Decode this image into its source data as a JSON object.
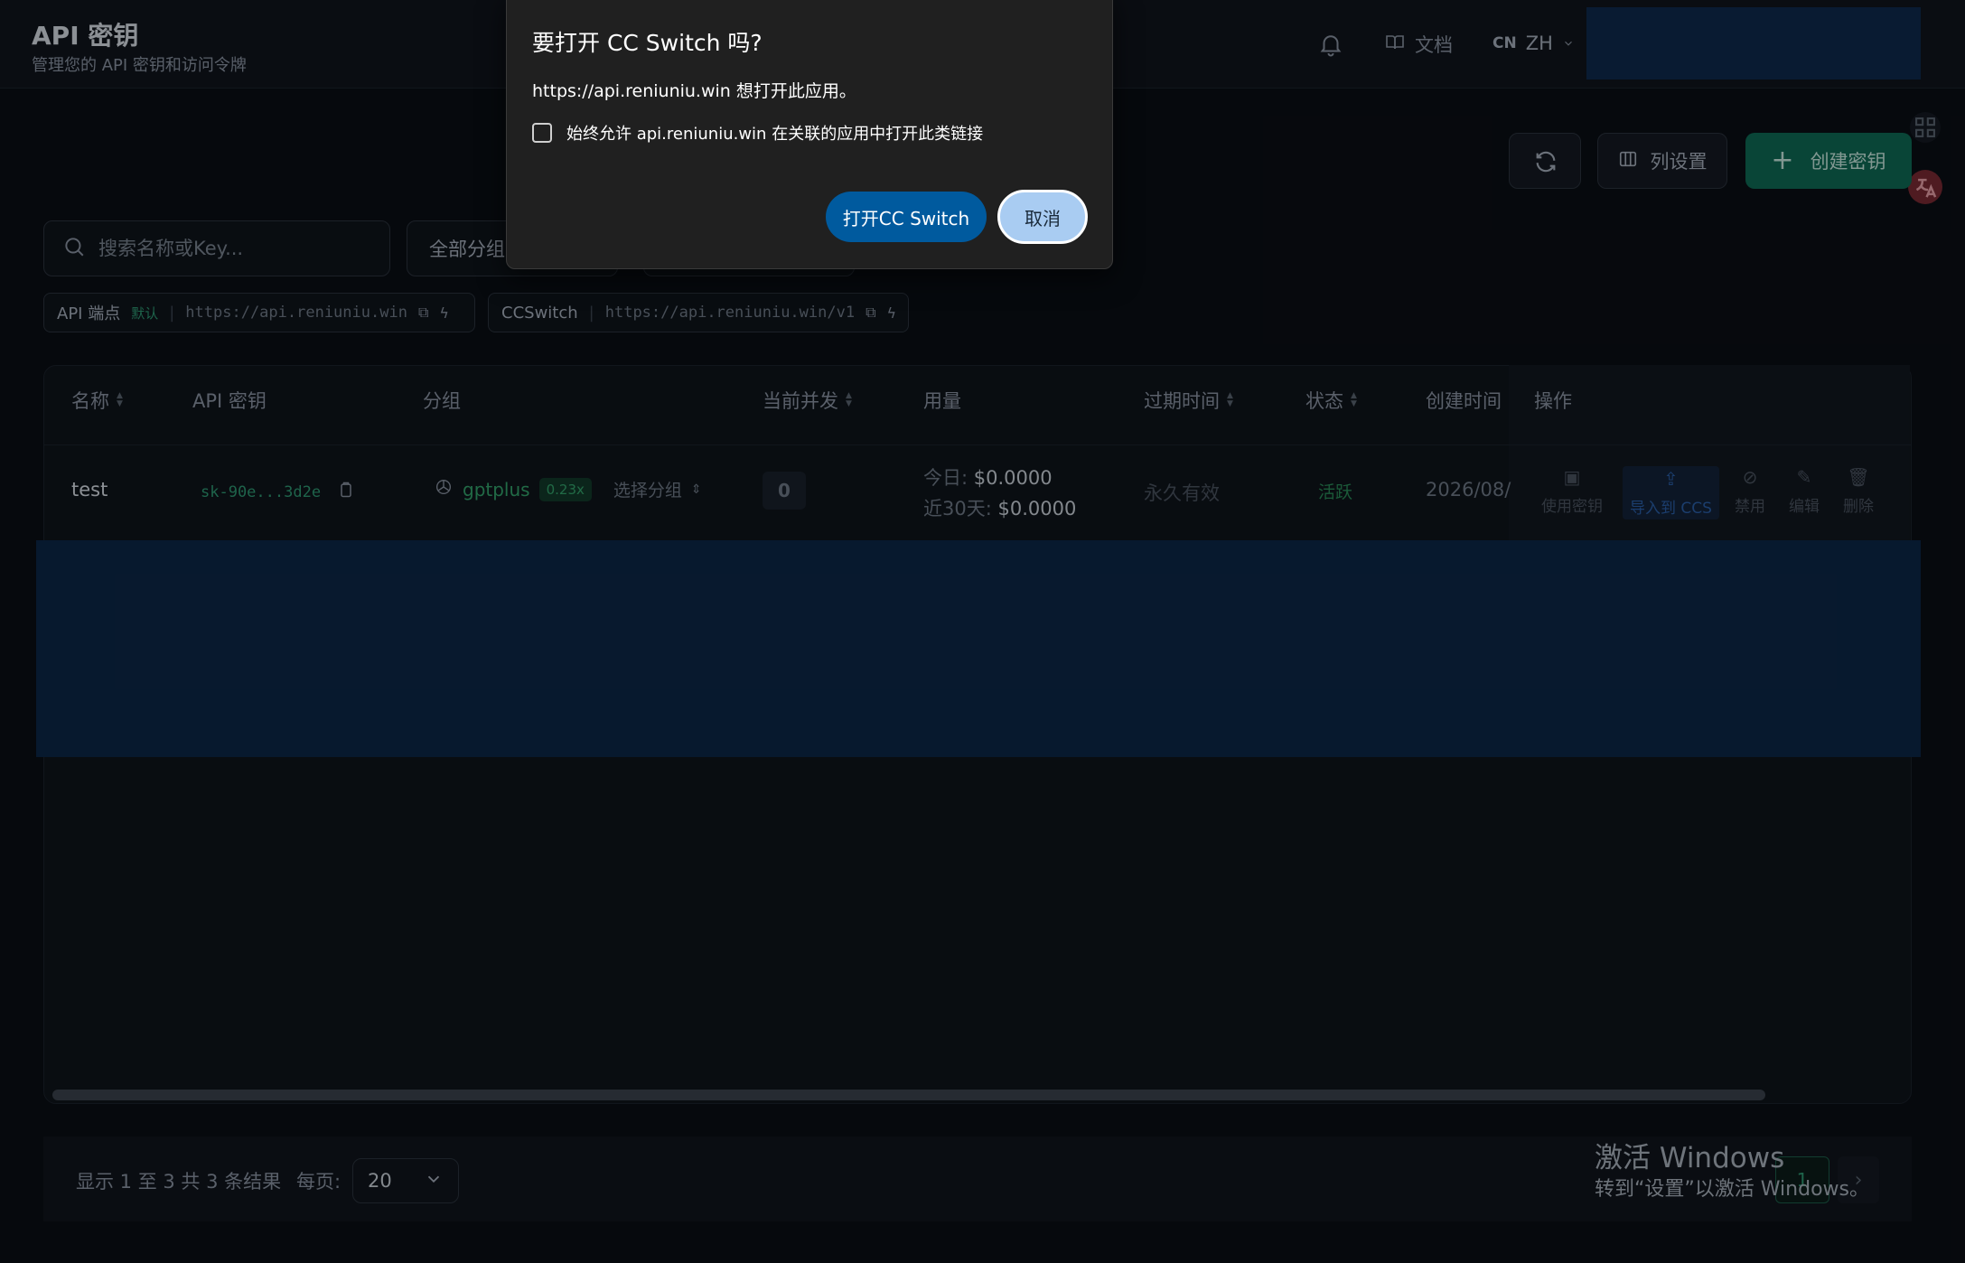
{
  "header": {
    "title": "API 密钥",
    "subtitle": "管理您的 API 密钥和访问令牌",
    "docs_label": "文档",
    "lang_code": "CN",
    "lang_label": "ZH"
  },
  "toolbar": {
    "columns_label": "列设置",
    "create_label": "创建密钥"
  },
  "filters": {
    "search_placeholder": "搜索名称或Key...",
    "group_label": "全部分组"
  },
  "endpoints": [
    {
      "name": "API 端点",
      "tag": "默认",
      "url": "https://api.reniuniu.win"
    },
    {
      "name": "CCSwitch",
      "url": "https://api.reniuniu.win/v1"
    }
  ],
  "table": {
    "columns": [
      "名称",
      "API 密钥",
      "分组",
      "当前并发",
      "用量",
      "过期时间",
      "状态",
      "创建时间",
      "操作"
    ],
    "rows": [
      {
        "name": "test",
        "key": "sk-90e...3d2e",
        "group": "gptplus",
        "ratio": "0.23x",
        "choose_group": "选择分组",
        "concurrency": "0",
        "usage_today_label": "今日:",
        "usage_today": "$0.0000",
        "usage_30d_label": "近30天:",
        "usage_30d": "$0.0000",
        "expire": "永久有效",
        "status": "活跃",
        "created": "2026/08/",
        "actions": [
          "使用密钥",
          "导入到 CCS",
          "禁用",
          "编辑",
          "删除"
        ]
      }
    ]
  },
  "pagination": {
    "summary": "显示 1 至 3 共 3 条结果",
    "per_page_label": "每页:",
    "per_page_value": "20",
    "current_page": "1"
  },
  "watermark": {
    "line1": "激活 Windows",
    "line2": "转到“设置”以激活 Windows。"
  },
  "dialog": {
    "title": "要打开 CC Switch 吗?",
    "message": "https://api.reniuniu.win 想打开此应用。",
    "checkbox_label": "始终允许 api.reniuniu.win 在关联的应用中打开此类链接",
    "open_label": "打开CC Switch",
    "cancel_label": "取消"
  },
  "colors": {
    "accent": "#0e6b55",
    "link_blue": "#005a9e",
    "band": "#0c2747"
  }
}
